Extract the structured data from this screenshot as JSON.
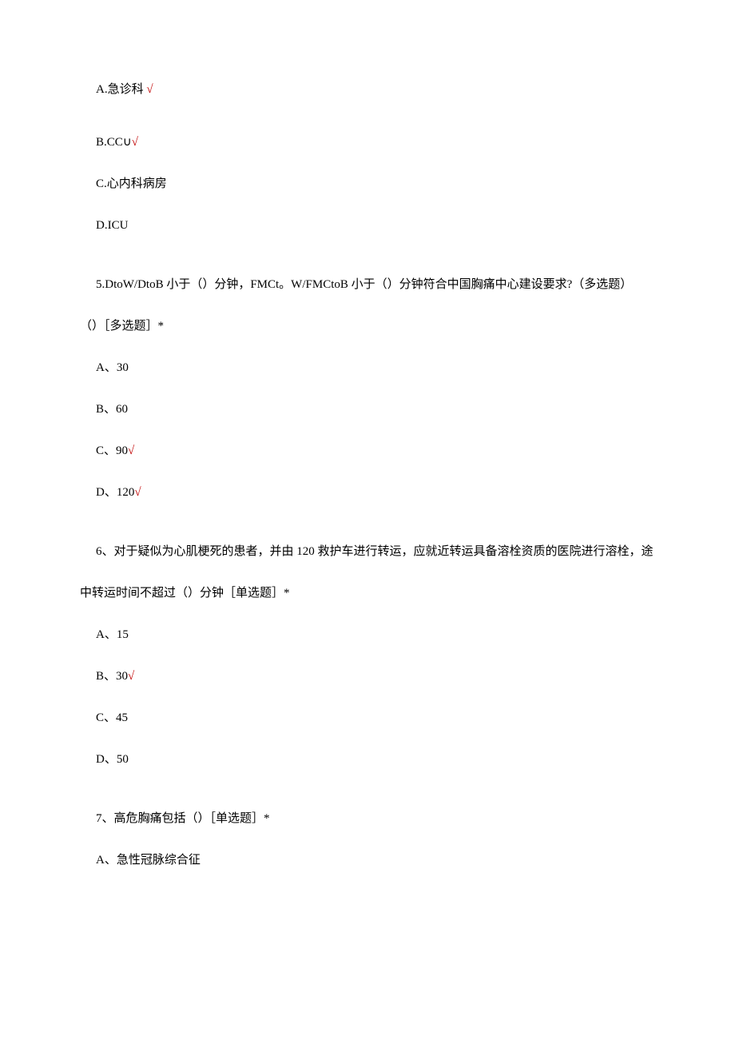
{
  "q4": {
    "o1": "A.急诊科",
    "o1_check": " √",
    "o2": "B.CC∪",
    "o2_check": "√",
    "o3": "C.心内科病房",
    "o4": "D.ICU"
  },
  "q5": {
    "text": "5.DtoW/DtoB 小于（）分钟，FMCt。W/FMCtoB 小于（）分钟符合中国胸痛中心建设要求?（多选题）",
    "text_cont": "（）［多选题］*",
    "o1": "A、30",
    "o2": "B、60",
    "o3": "C、90",
    "o3_check": "√",
    "o4": "D、120",
    "o4_check": "√"
  },
  "q6": {
    "text": "6、对于疑似为心肌梗死的患者，并由 120 救护车进行转运，应就近转运具备溶栓资质的医院进行溶栓，途",
    "text_cont": "中转运时间不超过（）分钟［单选题］*",
    "o1": "A、15",
    "o2": "B、30",
    "o2_check": "√",
    "o3": "C、45",
    "o4": "D、50"
  },
  "q7": {
    "text": "7、高危胸痛包括（）［单选题］*",
    "o1": "A、急性冠脉综合征"
  }
}
